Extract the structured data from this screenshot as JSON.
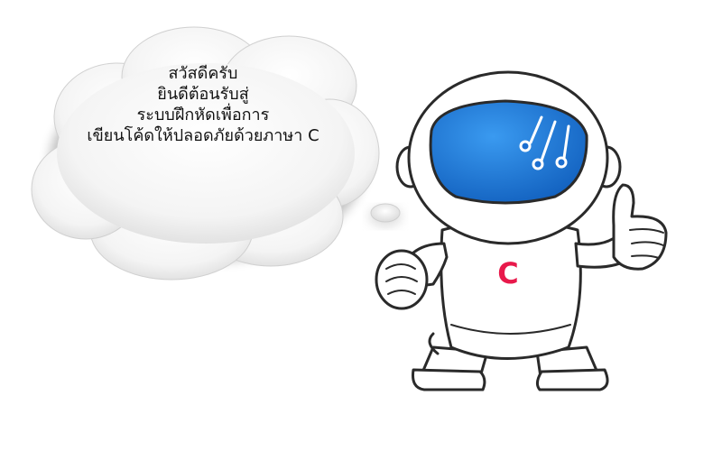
{
  "bubble": {
    "lines": [
      "สวัสดีครับ",
      "ยินดีต้อนรับสู่",
      "ระบบฝึกหัดเพื่อการ",
      "เขียนโค้ดให้ปลอดภัยด้วยภาษา C"
    ]
  },
  "robot": {
    "chest_letter": "C",
    "chest_letter_color": "#e8194b",
    "visor_color": "#1976d2"
  },
  "icons": [
    "thought-cloud-icon",
    "robot-mascot-icon",
    "circuit-icon"
  ]
}
